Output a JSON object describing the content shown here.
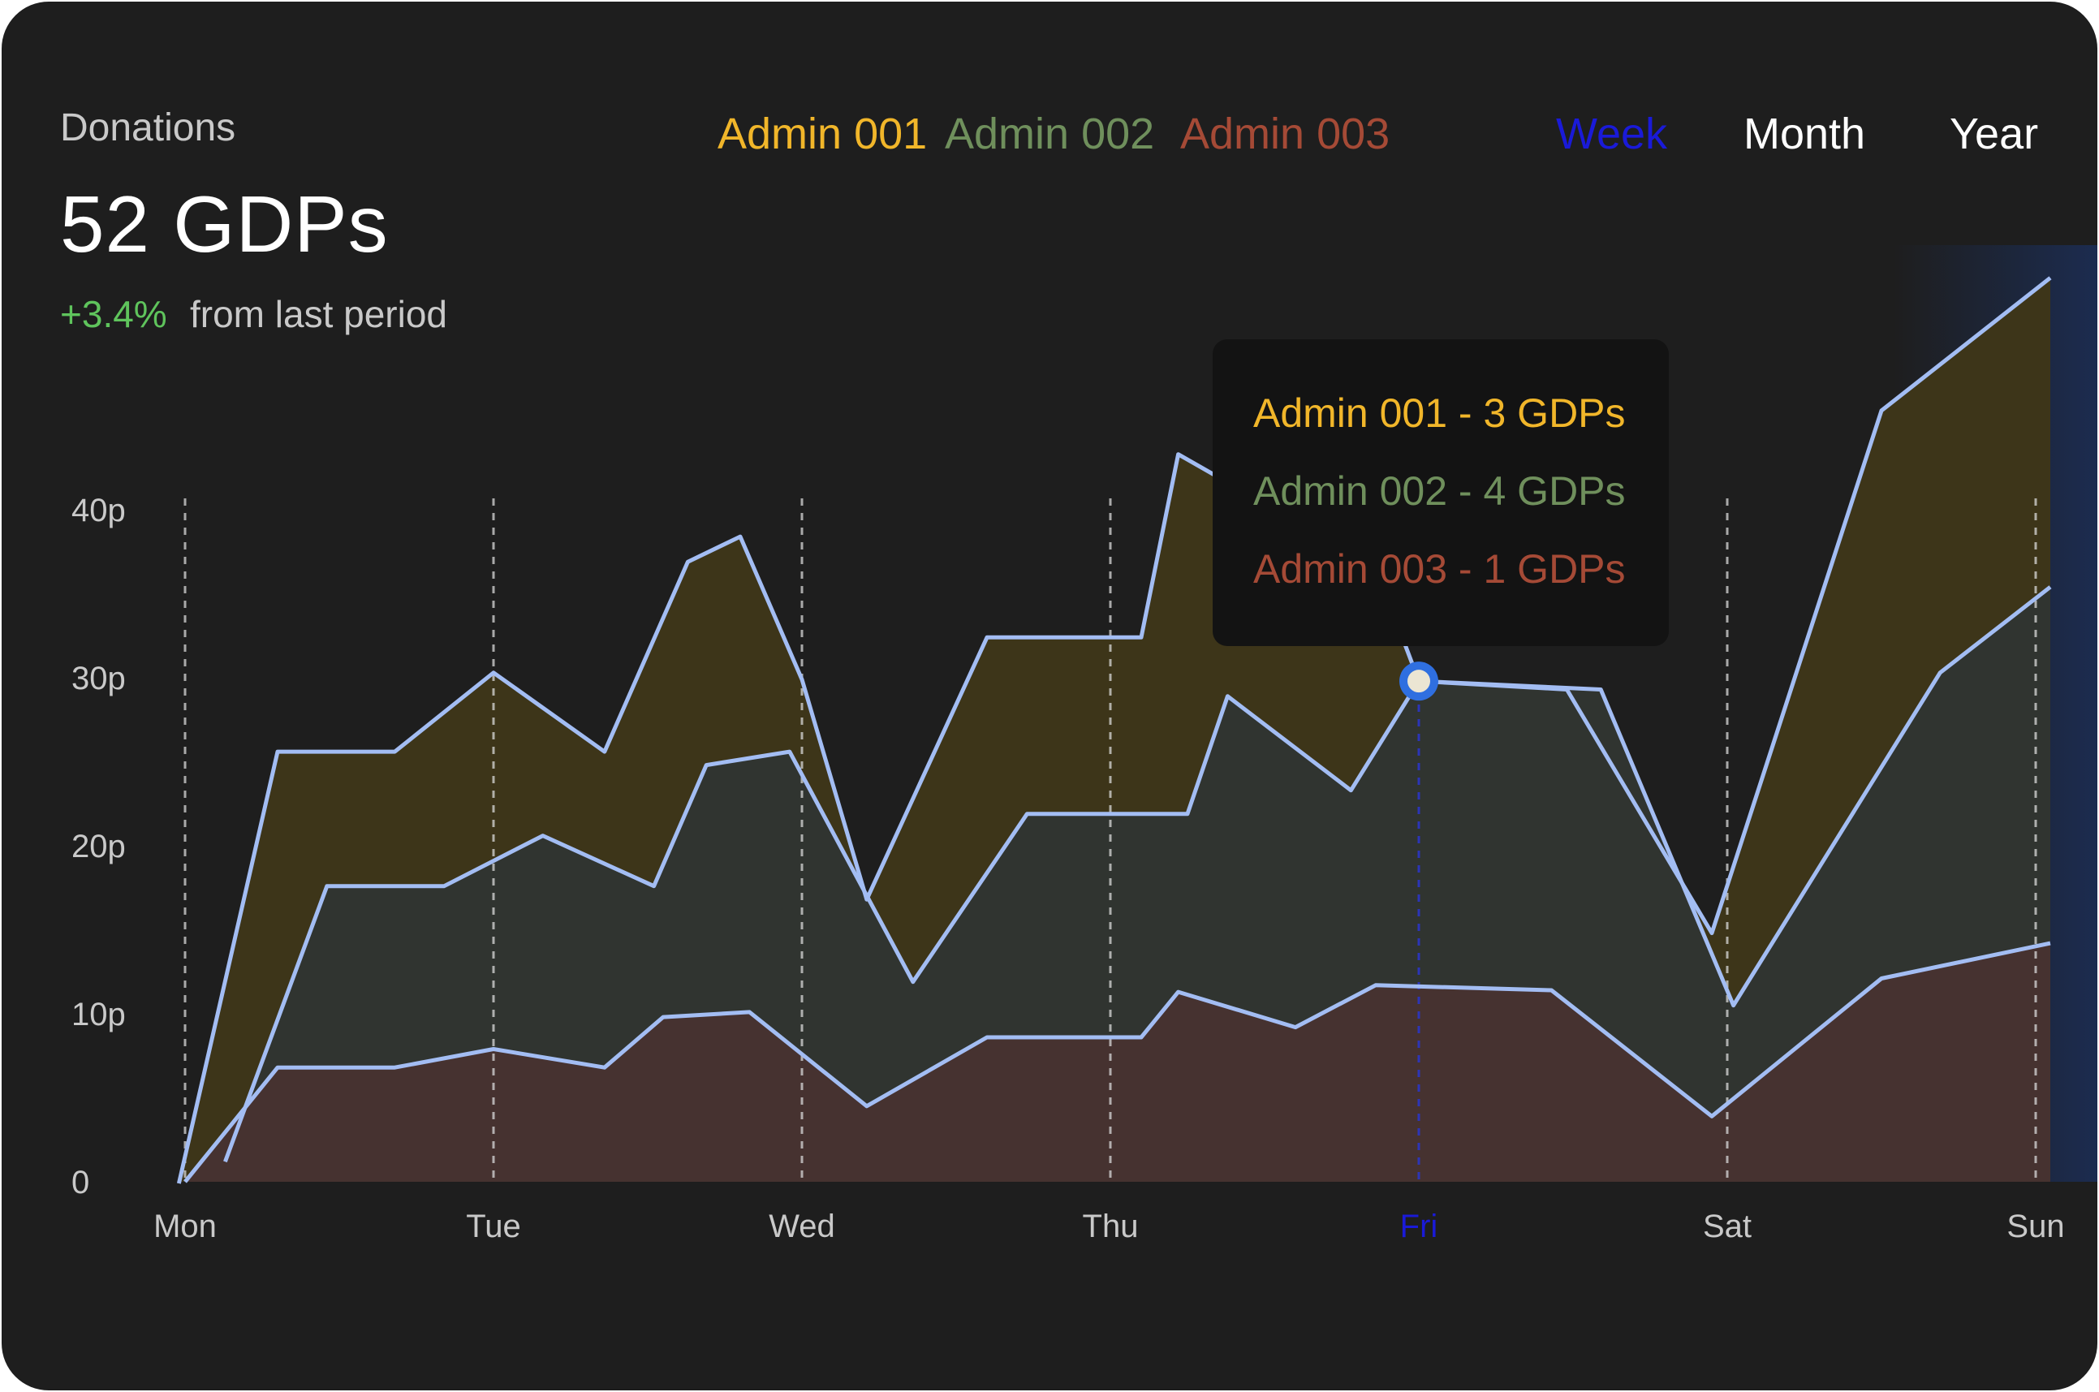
{
  "header": {
    "title": "Donations",
    "total": "52 GDPs",
    "change": "+3.4%",
    "change_suffix": "from last period"
  },
  "legend": [
    {
      "label": "Admin 001",
      "color": "#f1b62a"
    },
    {
      "label": "Admin 002",
      "color": "#6f8f5c"
    },
    {
      "label": "Admin 003",
      "color": "#a54a36"
    }
  ],
  "ranges": [
    {
      "label": "Week",
      "selected": true,
      "color": "#1a1ad8"
    },
    {
      "label": "Month",
      "selected": false,
      "color": "#ffffff"
    },
    {
      "label": "Year",
      "selected": false,
      "color": "#ffffff"
    }
  ],
  "tooltip": {
    "lines": [
      {
        "text": "Admin 001 - 3 GDPs",
        "color": "#f1b62a"
      },
      {
        "text": "Admin 002 - 4 GDPs",
        "color": "#6f8f5c"
      },
      {
        "text": "Admin 003 - 1 GDPs",
        "color": "#a54a36"
      }
    ]
  },
  "chart_data": {
    "type": "area",
    "categories": [
      "Mon",
      "Tue",
      "Wed",
      "Thu",
      "Fri",
      "Sat",
      "Sun"
    ],
    "highlight_category": "Fri",
    "y_ticks": [
      "0",
      "10p",
      "20p",
      "30p",
      "40p"
    ],
    "ylim": [
      0,
      40
    ],
    "series": [
      {
        "name": "Admin 001",
        "fill": "#3d3519",
        "x": [
          -0.02,
          0.3,
          0.68,
          1.0,
          1.36,
          1.63,
          1.8,
          2.0,
          2.21,
          2.6,
          3.1,
          3.22,
          3.86,
          4.0,
          4.48,
          4.95,
          5.5,
          6.15
        ],
        "y": [
          -0.1,
          25.6,
          25.6,
          30.3,
          25.6,
          36.9,
          38.4,
          29.9,
          16.8,
          32.4,
          32.4,
          43.3,
          36.6,
          29.8,
          29.3,
          14.8,
          45.9,
          53.8
        ]
      },
      {
        "name": "Admin 002",
        "fill": "#303430",
        "x": [
          0.13,
          0.46,
          0.84,
          1.16,
          1.52,
          1.69,
          1.96,
          2.36,
          2.73,
          3.25,
          3.38,
          3.78,
          4.0,
          4.59,
          5.02,
          5.69,
          6.15
        ],
        "y": [
          1.2,
          17.6,
          17.6,
          20.6,
          17.6,
          24.8,
          25.6,
          11.9,
          21.9,
          21.9,
          28.9,
          23.3,
          29.8,
          29.3,
          10.5,
          30.3,
          35.4
        ]
      },
      {
        "name": "Admin 003",
        "fill": "#463230",
        "x": [
          0.0,
          0.3,
          0.68,
          1.0,
          1.36,
          1.55,
          1.83,
          2.21,
          2.6,
          3.1,
          3.22,
          3.6,
          3.86,
          4.43,
          4.95,
          5.5,
          6.15
        ],
        "y": [
          0.0,
          6.8,
          6.8,
          7.9,
          6.8,
          9.8,
          10.1,
          4.5,
          8.6,
          8.6,
          11.3,
          9.2,
          11.7,
          11.4,
          3.9,
          12.1,
          14.2
        ]
      }
    ],
    "focus_point": {
      "x": 4.0,
      "y": 29.8
    }
  }
}
